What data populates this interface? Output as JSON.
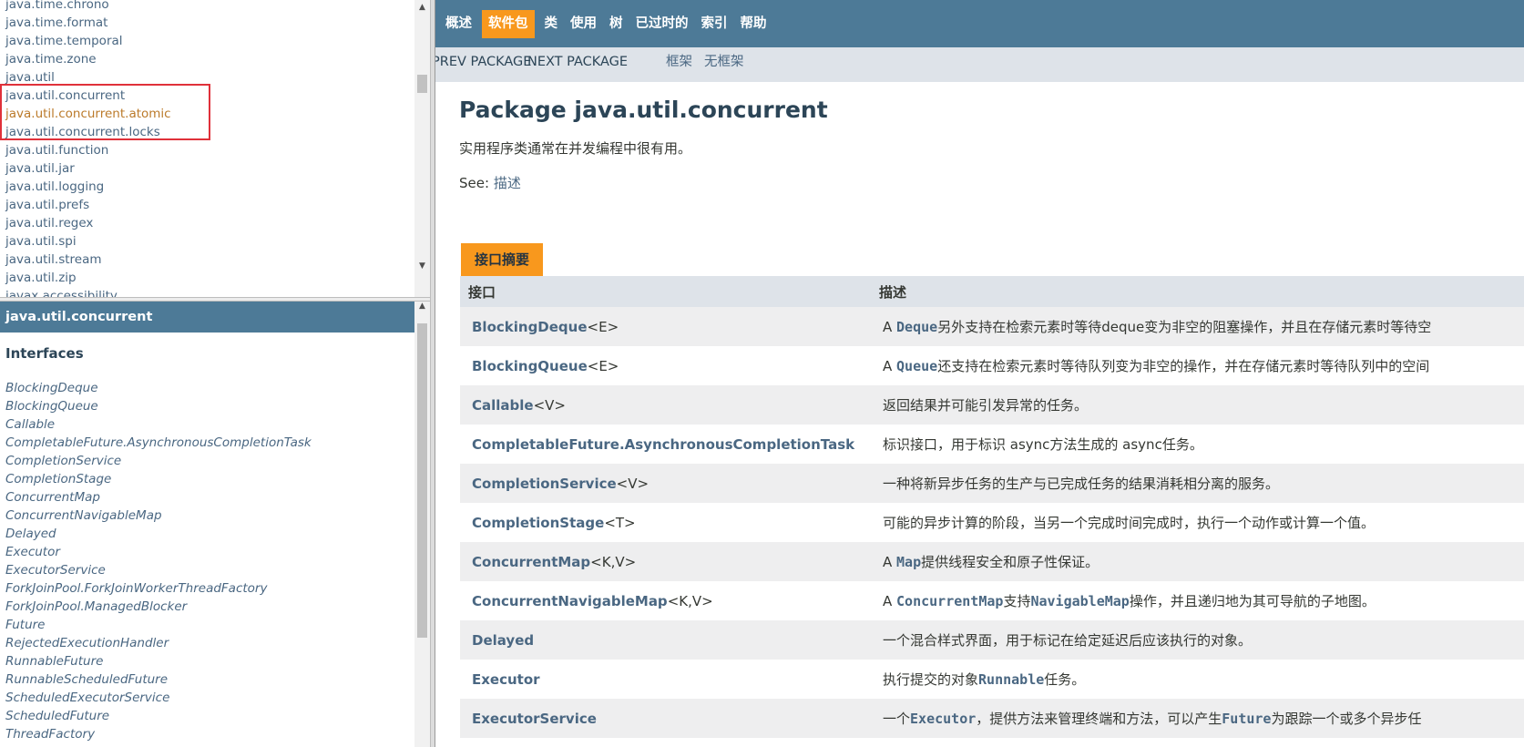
{
  "packages": [
    "java.time.chrono",
    "java.time.format",
    "java.time.temporal",
    "java.time.zone",
    "java.util",
    "java.util.concurrent",
    "java.util.concurrent.atomic",
    "java.util.concurrent.locks",
    "java.util.function",
    "java.util.jar",
    "java.util.logging",
    "java.util.prefs",
    "java.util.regex",
    "java.util.spi",
    "java.util.stream",
    "java.util.zip",
    "javax.accessibility"
  ],
  "package_frame": {
    "title": "java.util.concurrent",
    "interfaces_heading": "Interfaces",
    "interfaces": [
      "BlockingDeque",
      "BlockingQueue",
      "Callable",
      "CompletableFuture.AsynchronousCompletionTask",
      "CompletionService",
      "CompletionStage",
      "ConcurrentMap",
      "ConcurrentNavigableMap",
      "Delayed",
      "Executor",
      "ExecutorService",
      "ForkJoinPool.ForkJoinWorkerThreadFactory",
      "ForkJoinPool.ManagedBlocker",
      "Future",
      "RejectedExecutionHandler",
      "RunnableFuture",
      "RunnableScheduledFuture",
      "ScheduledExecutorService",
      "ScheduledFuture",
      "ThreadFactory"
    ]
  },
  "nav": {
    "items": [
      "概述",
      "软件包",
      "类",
      "使用",
      "树",
      "已过时的",
      "索引",
      "帮助"
    ],
    "current": "软件包",
    "prev_package": "PREV PACKAGE",
    "next_package": "NEXT PACKAGE",
    "frames": "框架",
    "no_frames": "无框架"
  },
  "page": {
    "title": "Package java.util.concurrent",
    "description": "实用程序类通常在并发编程中很有用。",
    "see_label": "See: ",
    "see_link": "描述"
  },
  "summary": {
    "tab_label": "接口摘要",
    "col_interface": "接口",
    "col_description": "描述",
    "rows": [
      {
        "name": "BlockingDeque",
        "type_params": "<E>",
        "desc": [
          "A ",
          {
            "code": "Deque"
          },
          "另外支持在检索元素时等待deque变为非空的阻塞操作，并且在存储元素时等待空"
        ]
      },
      {
        "name": "BlockingQueue",
        "type_params": "<E>",
        "desc": [
          "A ",
          {
            "code": "Queue"
          },
          "还支持在检索元素时等待队列变为非空的操作，并在存储元素时等待队列中的空间"
        ]
      },
      {
        "name": "Callable",
        "type_params": "<V>",
        "desc": [
          "返回结果并可能引发异常的任务。"
        ]
      },
      {
        "name": "CompletableFuture.AsynchronousCompletionTask",
        "type_params": "",
        "desc": [
          "标识接口，用于标识 async方法生成的 async任务。"
        ]
      },
      {
        "name": "CompletionService",
        "type_params": "<V>",
        "desc": [
          "一种将新异步任务的生产与已完成任务的结果消耗相分离的服务。"
        ]
      },
      {
        "name": "CompletionStage",
        "type_params": "<T>",
        "desc": [
          "可能的异步计算的阶段，当另一个完成时间完成时，执行一个动作或计算一个值。"
        ]
      },
      {
        "name": "ConcurrentMap",
        "type_params": "<K,V>",
        "desc": [
          "A ",
          {
            "code": "Map"
          },
          "提供线程安全和原子性保证。"
        ]
      },
      {
        "name": "ConcurrentNavigableMap",
        "type_params": "<K,V>",
        "desc": [
          "A ",
          {
            "code": "ConcurrentMap"
          },
          "支持",
          {
            "code": "NavigableMap"
          },
          "操作，并且递归地为其可导航的子地图。"
        ]
      },
      {
        "name": "Delayed",
        "type_params": "",
        "desc": [
          "一个混合样式界面，用于标记在给定延迟后应该执行的对象。"
        ]
      },
      {
        "name": "Executor",
        "type_params": "",
        "desc": [
          "执行提交的对象",
          {
            "code": "Runnable"
          },
          "任务。"
        ]
      },
      {
        "name": "ExecutorService",
        "type_params": "",
        "desc": [
          "一个",
          {
            "code": "Executor"
          },
          "，提供方法来管理终端和方法，可以产生",
          {
            "code": "Future"
          },
          "为跟踪一个或多个异步任"
        ]
      }
    ]
  }
}
